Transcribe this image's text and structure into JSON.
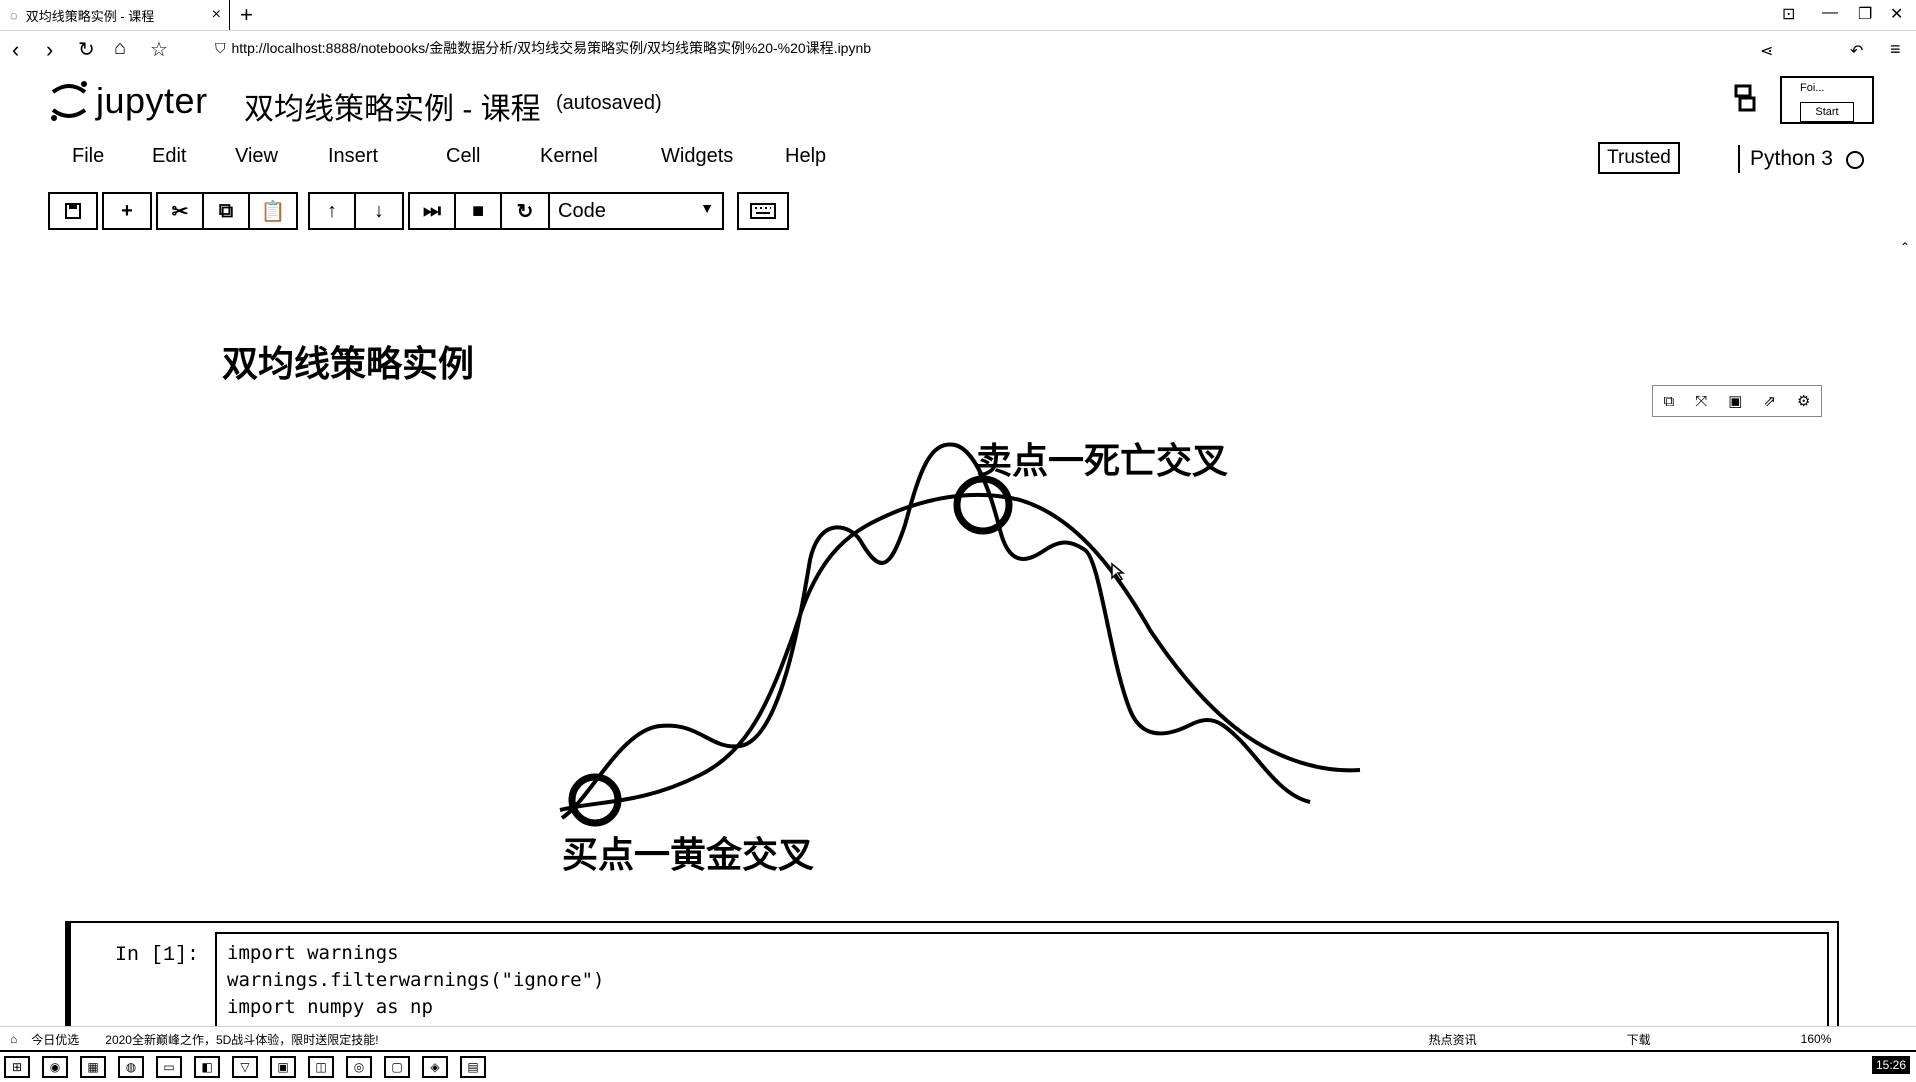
{
  "browser": {
    "tab_title": "双均线策略实例 - 课程",
    "tab_close": "×",
    "new_tab": "+",
    "url": "http://localhost:8888/notebooks/金融数据分析/双均线交易策略实例/双均线策略实例%20-%20课程.ipynb",
    "window_controls": [
      "⊡",
      "—",
      "❐",
      "✕"
    ]
  },
  "jupyter": {
    "logo_text": "jupyter",
    "notebook_title": "双均线策略实例 - 课程",
    "autosaved": "(autosaved)",
    "menu": [
      "File",
      "Edit",
      "View",
      "Insert",
      "Cell",
      "Kernel",
      "Widgets",
      "Help"
    ],
    "trusted": "Trusted",
    "kernel": "Python 3",
    "cell_type": "Code"
  },
  "recorder": {
    "line1": "Foi...",
    "line2": "Start"
  },
  "notebook": {
    "heading": "双均线策略实例",
    "diagram": {
      "sell_label": "卖点一死亡交叉",
      "buy_label": "买点一黄金交叉"
    },
    "code_cell": {
      "prompt": "In  [1]:",
      "lines": [
        "import warnings",
        "warnings.filterwarnings(\"ignore\")",
        "import numpy as np"
      ]
    }
  },
  "statusbar": {
    "left1": "今日优选",
    "left2": "2020全新巅峰之作，5D战斗体验，限时送限定技能!",
    "right_items": [
      "热点资讯",
      "下载",
      "160%"
    ]
  },
  "taskbar": {
    "clock": "15:26"
  }
}
